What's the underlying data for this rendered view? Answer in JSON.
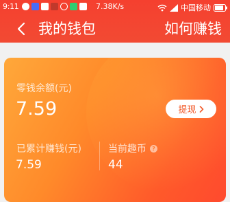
{
  "status_bar": {
    "time": "9:11",
    "net_speed": "7.38K/s",
    "carrier": "中国移动",
    "icons": [
      "location-icon",
      "app-icon",
      "shield-icon",
      "game-icon",
      "chat-icon",
      "download-icon",
      "video-icon"
    ],
    "right_icons": [
      "wifi-icon",
      "signal-icon",
      "battery-icon"
    ]
  },
  "header": {
    "back_icon": "chevron-left-icon",
    "title": "我的钱包",
    "right_link": "如何赚钱"
  },
  "wallet": {
    "balance_label": "零钱余额(元)",
    "balance_value": "7.59",
    "withdraw_label": "提现",
    "withdraw_icon": "chevron-right-icon",
    "earned_label": "已累计赚钱(元)",
    "earned_value": "7.59",
    "coins_label": "当前趣币",
    "coins_value": "44",
    "help_icon": "question-icon"
  },
  "colors": {
    "header_bg": "#f5402f",
    "card_gradient_start": "#ffa83a",
    "card_gradient_end": "#ff4a2e",
    "withdraw_text": "#f25a2a",
    "page_bg": "#f1f1f1"
  }
}
